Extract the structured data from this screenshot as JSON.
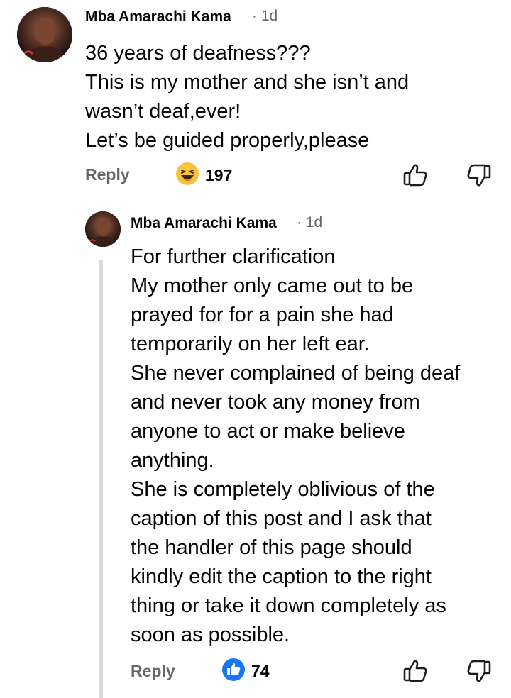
{
  "comments": [
    {
      "author": "Mba Amarachi Kama",
      "time": "· 1d",
      "text": "36 years of deafness???\nThis is my mother and she isn’t and\nwasn’t deaf,ever!\nLet’s be guided properly,please",
      "reply_label": "Reply",
      "reaction_icon": "haha-emoji-icon",
      "reaction_count": "197"
    },
    {
      "author": "Mba Amarachi Kama",
      "time": "· 1d",
      "text": "For further clarification\nMy mother only came out to be\nprayed for for a pain she had\ntemporarily on her left ear.\nShe never complained of being deaf\nand never took any money from\nanyone to act or make believe\nanything.\nShe is completely oblivious of the\ncaption of this post and I ask that\nthe handler of this page should\nkindly edit the caption to the right\nthing or take it down completely as\nsoon as possible.",
      "reply_label": "Reply",
      "reaction_icon": "like-icon",
      "reaction_count": "74"
    }
  ],
  "colors": {
    "like_blue": "#1877f2",
    "emoji_yellow": "#f7c33b",
    "muted_text": "#65676b",
    "thread_line": "#d9d9d9"
  }
}
